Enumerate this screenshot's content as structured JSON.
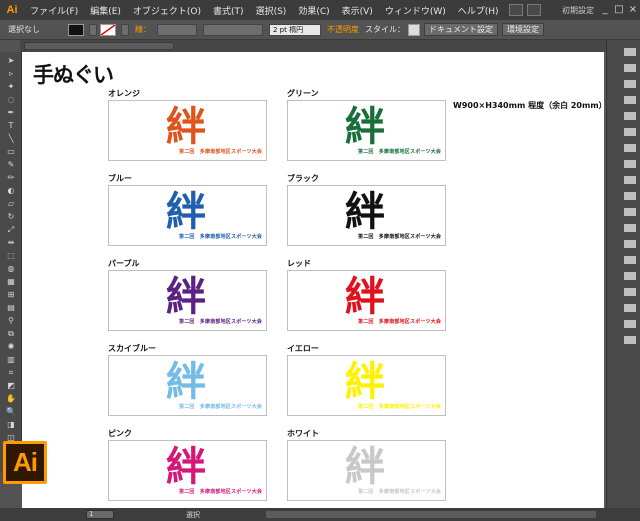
{
  "app": {
    "logo": "Ai",
    "menus": [
      "ファイル(F)",
      "編集(E)",
      "オブジェクト(O)",
      "書式(T)",
      "選択(S)",
      "効果(C)",
      "表示(V)",
      "ウィンドウ(W)",
      "ヘルプ(H)"
    ],
    "workspace": "初期設定",
    "window_controls": [
      "_",
      "□",
      "×"
    ]
  },
  "control_bar": {
    "selection": "選択なし",
    "stroke_label": "線：",
    "stroke_width": "2 pt 楕円",
    "opacity_label": "不透明度",
    "style_label": "スタイル：",
    "doc_settings_button": "ドキュメント設定",
    "preferences_button": "環境設定"
  },
  "document": {
    "title": "手ぬぐい",
    "size_note": "W900×H340mm 程度（余白 20mm）",
    "kanji": "絆",
    "event_text": "第二回　多摩南部地区スポーツ大会",
    "cards": [
      {
        "label": "オレンジ",
        "color": "#e0531c"
      },
      {
        "label": "グリーン",
        "color": "#1a6e3a"
      },
      {
        "label": "ブルー",
        "color": "#1f5fae"
      },
      {
        "label": "ブラック",
        "color": "#111111"
      },
      {
        "label": "パープル",
        "color": "#5b2283"
      },
      {
        "label": "レッド",
        "color": "#e0101c"
      },
      {
        "label": "スカイブルー",
        "color": "#74bce6"
      },
      {
        "label": "イエロー",
        "color": "#fff200"
      },
      {
        "label": "ピンク",
        "color": "#d6177a"
      },
      {
        "label": "ホワイト",
        "color": "#c8c8c8"
      }
    ]
  },
  "status_bar": {
    "zoom": "1",
    "tool": "選択"
  },
  "colors": {
    "accent": "#ff9a00",
    "ui_bg": "#535353"
  }
}
